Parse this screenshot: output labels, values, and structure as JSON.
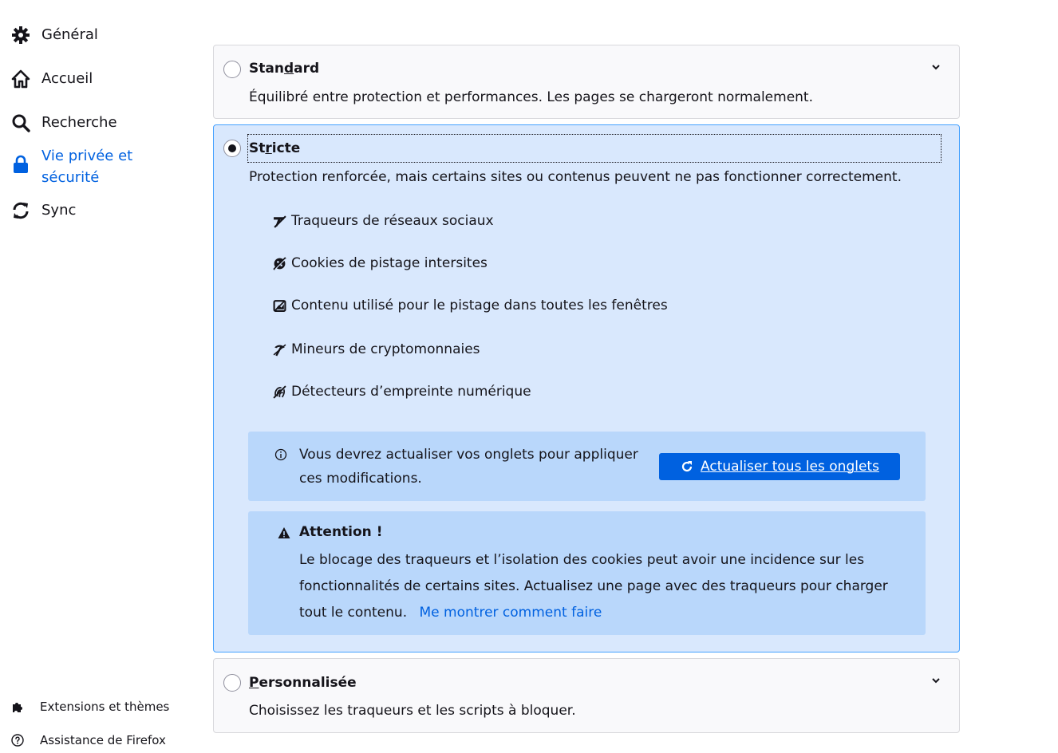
{
  "sidebar": {
    "items": [
      {
        "name": "general",
        "label": "Général",
        "icon": "gear-icon"
      },
      {
        "name": "home",
        "label": "Accueil",
        "icon": "home-icon"
      },
      {
        "name": "search",
        "label": "Recherche",
        "icon": "search-icon"
      },
      {
        "name": "privacy",
        "label": "Vie privée et sécurité",
        "icon": "lock-icon",
        "active": true
      },
      {
        "name": "sync",
        "label": "Sync",
        "icon": "sync-icon"
      }
    ],
    "bottom": [
      {
        "label": "Extensions et thèmes",
        "icon": "puzzle-icon"
      },
      {
        "label": "Assistance de Firefox",
        "icon": "help-icon"
      }
    ],
    "accent_color": "#0061e0"
  },
  "standard": {
    "title_pre": "Stan",
    "title_key": "d",
    "title_post": "ard",
    "description": "Équilibré entre protection et performances. Les pages se chargeront normalement."
  },
  "strict": {
    "title_pre": "St",
    "title_key": "r",
    "title_post": "icte",
    "description": "Protection renforcée, mais certains sites ou contenus peuvent ne pas fonctionner correctement.",
    "trackers": [
      {
        "label": "Traqueurs de réseaux sociaux",
        "icon": "social-tracker-icon"
      },
      {
        "label": "Cookies de pistage intersites",
        "icon": "cookie-icon"
      },
      {
        "label": "Contenu utilisé pour le pistage dans toutes les fenêtres",
        "icon": "tracking-content-icon"
      },
      {
        "label": "Mineurs de cryptomonnaies",
        "icon": "cryptominer-icon"
      },
      {
        "label": "Détecteurs d’empreinte numérique",
        "icon": "fingerprint-icon"
      }
    ],
    "reload_notice": "Vous devrez actualiser vos onglets pour appliquer ces modifications.",
    "reload_button_key": "A",
    "reload_button_rest": "ctualiser tous les onglets",
    "warning_title": "Attention !",
    "warning_text": "Le blocage des traqueurs et l’isolation des cookies peut avoir une incidence sur les fonctionnalités de certains sites. Actualisez une page avec des traqueurs pour charger tout le contenu.",
    "warning_link": "Me montrer comment faire"
  },
  "custom": {
    "title_key": "P",
    "title_post": "ersonnalisée",
    "description": "Choisissez les traqueurs et les scripts à bloquer."
  },
  "colors": {
    "selected_bg": "#d9e8fd",
    "selected_border": "#45a1ff",
    "notice_bg": "#b9d7fb",
    "button_bg": "#0061e0"
  }
}
